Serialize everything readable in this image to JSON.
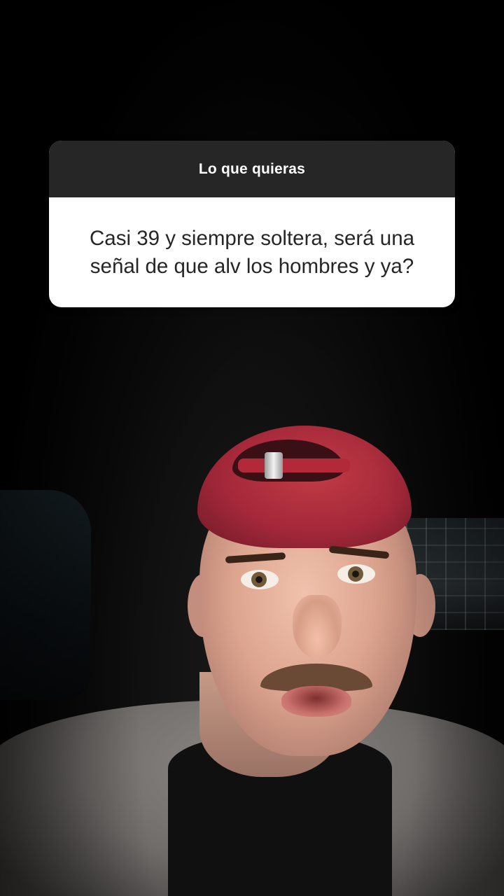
{
  "question_sticker": {
    "title": "Lo que quieras",
    "text": "Casi 39 y siempre soltera, será una señal de que alv los hombres y ya?"
  },
  "colors": {
    "sticker_header": "#262626",
    "sticker_body": "#ffffff",
    "sticker_text": "#262626",
    "cap": "#a4283a",
    "background": "#000000"
  }
}
